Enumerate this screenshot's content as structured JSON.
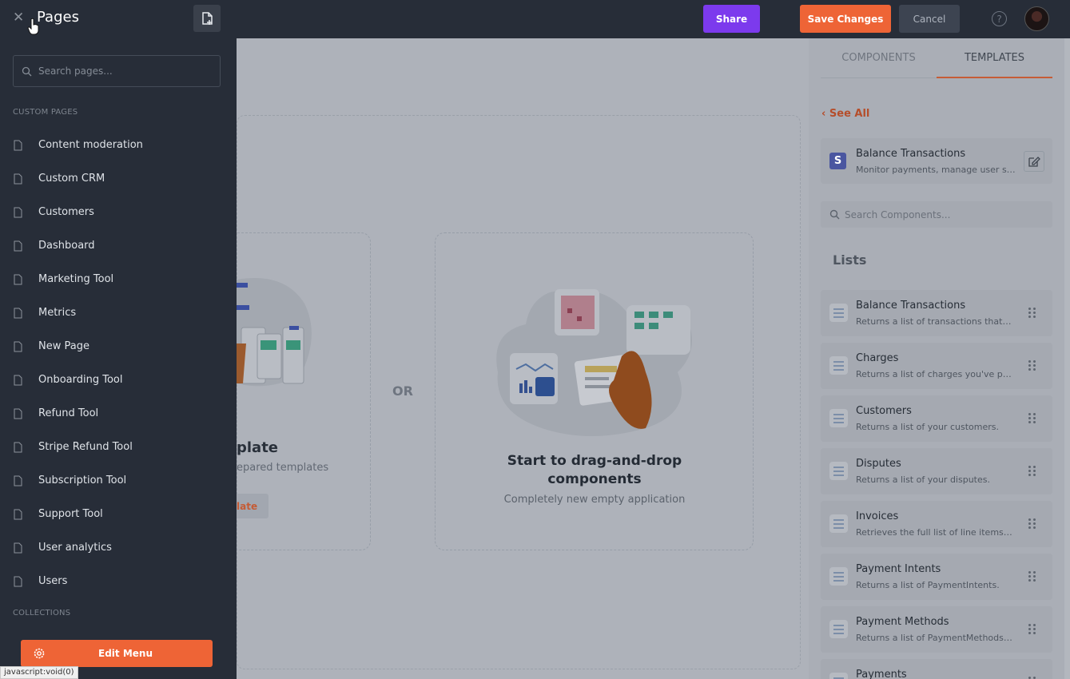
{
  "topbar": {
    "share_label": "Share",
    "save_label": "Save Changes",
    "cancel_label": "Cancel",
    "help_icon": "?",
    "colors": {
      "share": "#7c3aed",
      "save": "#ee6436"
    }
  },
  "canvas": {
    "or_label": "OR",
    "template_card": {
      "title": "plate",
      "subtitle": "epared templates",
      "button": "late"
    },
    "dnd_card": {
      "title": "Start to drag-and-drop components",
      "subtitle": "Completely new empty application"
    }
  },
  "right_panel": {
    "tabs": [
      {
        "label": "COMPONENTS"
      },
      {
        "label": "TEMPLATES"
      }
    ],
    "see_all": "See All",
    "featured": {
      "logo": "S",
      "title": "Balance Transactions",
      "description": "Monitor payments, manage user subscriptions"
    },
    "search_placeholder": "Search Components...",
    "lists_heading": "Lists",
    "items": [
      {
        "title": "Balance Transactions",
        "desc": "Returns a list of transactions that have contributed to the balance"
      },
      {
        "title": "Charges",
        "desc": "Returns a list of charges you've previously created"
      },
      {
        "title": "Customers",
        "desc": "Returns a list of your customers."
      },
      {
        "title": "Disputes",
        "desc": "Returns a list of your disputes."
      },
      {
        "title": "Invoices",
        "desc": "Retrieves the full list of line items of an invoice"
      },
      {
        "title": "Payment Intents",
        "desc": "Returns a list of PaymentIntents."
      },
      {
        "title": "Payment Methods",
        "desc": "Returns a list of PaymentMethods for a customer"
      },
      {
        "title": "Payments",
        "desc": ""
      }
    ]
  },
  "drawer": {
    "title": "Pages",
    "close_icon": "✕",
    "search_placeholder": "Search pages...",
    "custom_pages_heading": "CUSTOM PAGES",
    "pages": [
      "Content moderation",
      "Custom CRM",
      "Customers",
      "Dashboard",
      "Marketing Tool",
      "Metrics",
      "New Page",
      "Onboarding Tool",
      "Refund Tool",
      "Stripe Refund Tool",
      "Subscription Tool",
      "Support Tool",
      "User analytics",
      "Users"
    ],
    "collections_heading": "COLLECTIONS",
    "edit_menu_label": "Edit Menu"
  },
  "status_tip": "javascript:void(0)"
}
